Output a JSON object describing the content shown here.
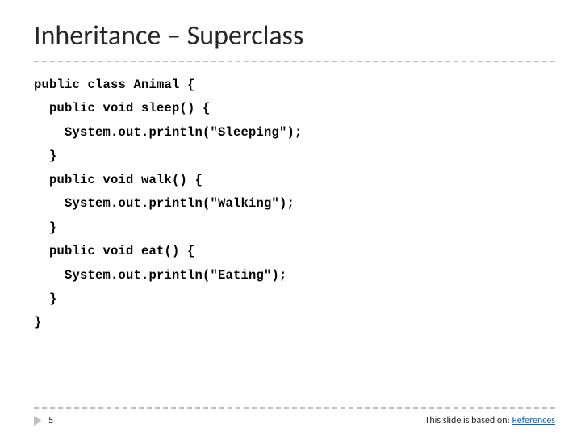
{
  "title": "Inheritance – Superclass",
  "code": {
    "l0": "public class Animal {",
    "l1": "  public void sleep() {",
    "l2": "    System.out.println(\"Sleeping\");",
    "l3": "  }",
    "l4": "  public void walk() {",
    "l5": "    System.out.println(\"Walking\");",
    "l6": "  }",
    "l7": "  public void eat() {",
    "l8": "    System.out.println(\"Eating\");",
    "l9": "  }",
    "l10": "}"
  },
  "footer": {
    "page_number": "5",
    "based_on_prefix": "This slide is based on: ",
    "references_label": "References"
  }
}
